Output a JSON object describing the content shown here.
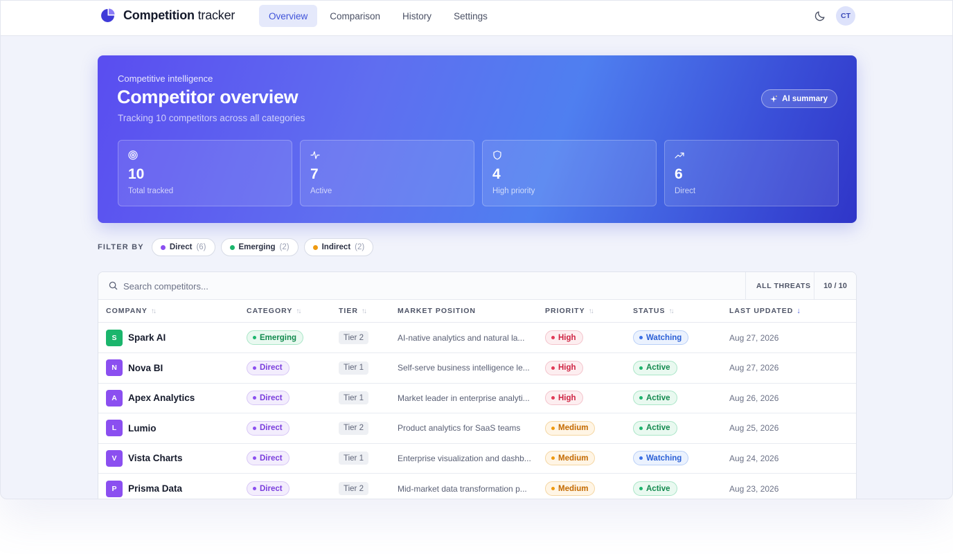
{
  "nav": {
    "brand_bold": "Competition",
    "brand_light": " tracker",
    "tabs": [
      {
        "label": "Overview",
        "active": true
      },
      {
        "label": "Comparison",
        "active": false
      },
      {
        "label": "History",
        "active": false
      },
      {
        "label": "Settings",
        "active": false
      }
    ],
    "theme_icon": "moon-icon",
    "avatar_initials": "CT"
  },
  "hero": {
    "eyebrow": "Competitive intelligence",
    "title": "Competitor overview",
    "subtitle": "Tracking 10 competitors across all categories",
    "ai_button": "AI summary",
    "stats": [
      {
        "icon": "target-icon",
        "value": "10",
        "label": "Total tracked"
      },
      {
        "icon": "activity-icon",
        "value": "7",
        "label": "Active"
      },
      {
        "icon": "shield-icon",
        "value": "4",
        "label": "High priority"
      },
      {
        "icon": "trending-up-icon",
        "value": "6",
        "label": "Direct"
      }
    ]
  },
  "filters": {
    "label": "FILTER BY",
    "chips": [
      {
        "label": "Direct",
        "count": "(6)",
        "color": "#8b4ff0"
      },
      {
        "label": "Emerging",
        "count": "(2)",
        "color": "#1bb56c"
      },
      {
        "label": "Indirect",
        "count": "(2)",
        "color": "#ef9a10"
      }
    ]
  },
  "table": {
    "search_placeholder": "Search competitors...",
    "threats_label": "ALL THREATS",
    "count": "10 / 10",
    "headers": {
      "company": "COMPANY",
      "category": "CATEGORY",
      "tier": "TIER",
      "market": "MARKET POSITION",
      "priority": "PRIORITY",
      "status": "STATUS",
      "updated": "LAST UPDATED"
    },
    "rows": [
      {
        "initial": "S",
        "badge_color": "#1bb56c",
        "name": "Spark AI",
        "category": "Emerging",
        "tier": "Tier 2",
        "market": "AI-native analytics and natural la...",
        "priority": "High",
        "status": "Watching",
        "updated": "Aug 27, 2026"
      },
      {
        "initial": "N",
        "badge_color": "#8b4ff0",
        "name": "Nova BI",
        "category": "Direct",
        "tier": "Tier 1",
        "market": "Self-serve business intelligence le...",
        "priority": "High",
        "status": "Active",
        "updated": "Aug 27, 2026"
      },
      {
        "initial": "A",
        "badge_color": "#8b4ff0",
        "name": "Apex Analytics",
        "category": "Direct",
        "tier": "Tier 1",
        "market": "Market leader in enterprise analyti...",
        "priority": "High",
        "status": "Active",
        "updated": "Aug 26, 2026"
      },
      {
        "initial": "L",
        "badge_color": "#8b4ff0",
        "name": "Lumio",
        "category": "Direct",
        "tier": "Tier 2",
        "market": "Product analytics for SaaS teams",
        "priority": "Medium",
        "status": "Active",
        "updated": "Aug 25, 2026"
      },
      {
        "initial": "V",
        "badge_color": "#8b4ff0",
        "name": "Vista Charts",
        "category": "Direct",
        "tier": "Tier 1",
        "market": "Enterprise visualization and dashb...",
        "priority": "Medium",
        "status": "Watching",
        "updated": "Aug 24, 2026"
      },
      {
        "initial": "P",
        "badge_color": "#8b4ff0",
        "name": "Prisma Data",
        "category": "Direct",
        "tier": "Tier 2",
        "market": "Mid-market data transformation p...",
        "priority": "Medium",
        "status": "Active",
        "updated": "Aug 23, 2026"
      }
    ]
  }
}
